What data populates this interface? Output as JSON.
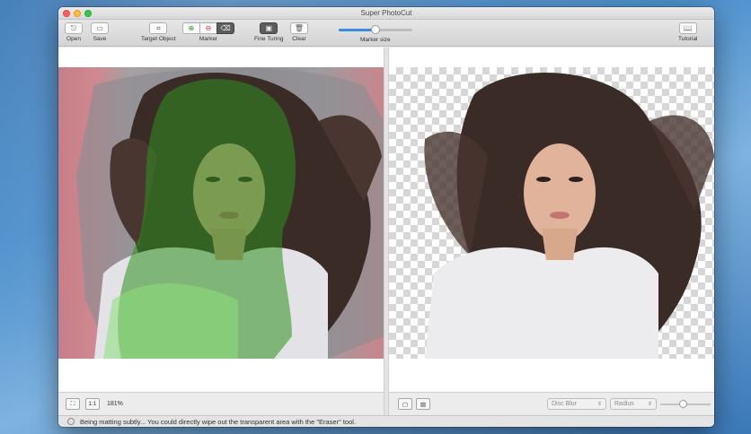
{
  "window": {
    "title": "Super PhotoCut"
  },
  "toolbar": {
    "open_label": "Open",
    "save_label": "Save",
    "target_object_label": "Target Object",
    "marker_label": "Marker",
    "fine_tuning_label": "Fine Turing",
    "clear_label": "Clear",
    "marker_size_label": "Marker size",
    "tutorial_label": "Tutorial",
    "marker_size_value": 0.5
  },
  "left_pane": {
    "fit_label": "⛶",
    "actual_label": "1:1",
    "zoom_label": "181%"
  },
  "right_pane": {
    "blur_select": "Disc Blur",
    "radius_select": "Radius",
    "radius_value": 0.45
  },
  "status": {
    "message": "Being matting subtly... You could directly wipe out the transparent area with the \"Eraser\" tool."
  },
  "colors": {
    "accent": "#3a8ae0",
    "mask_green": "#2f8f1f",
    "background_red": "#c87e86"
  }
}
